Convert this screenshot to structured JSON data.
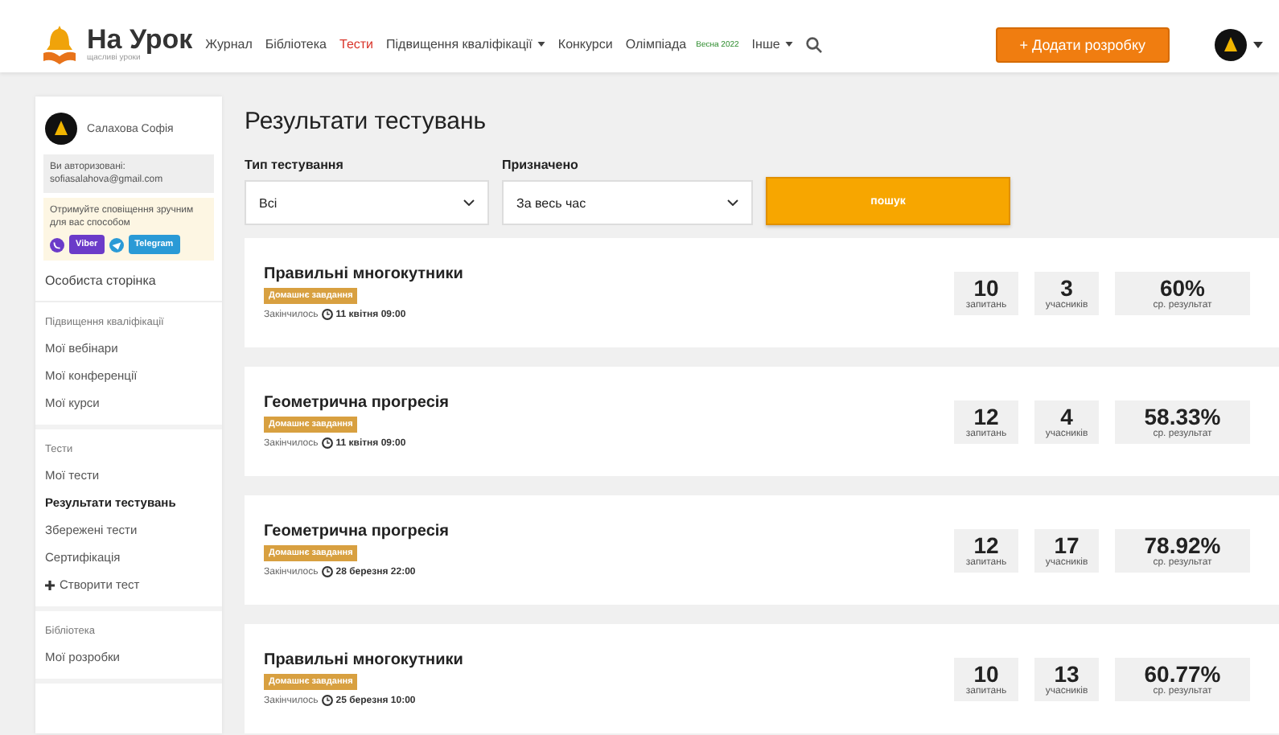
{
  "header": {
    "logo": "На Урок",
    "tagline": "щасливі уроки",
    "nav": [
      {
        "label": "Журнал",
        "selected": false,
        "dropdown": false
      },
      {
        "label": "Бібліотека",
        "selected": false,
        "dropdown": false
      },
      {
        "label": "Тести",
        "selected": true,
        "dropdown": false
      },
      {
        "label": "Підвищення кваліфікації",
        "selected": false,
        "dropdown": true
      },
      {
        "label": "Конкурси",
        "selected": false,
        "dropdown": false
      },
      {
        "label": "Олімпіада",
        "selected": false,
        "dropdown": false,
        "badge": "Весна 2022"
      },
      {
        "label": "Інше",
        "selected": false,
        "dropdown": true
      }
    ],
    "add_button": "+ Додати розробку"
  },
  "sidebar": {
    "user_name": "Салахова Софія",
    "auth_label": "Ви авторизовані:",
    "auth_email": "sofiasalahova@gmail.com",
    "notify_text": "Отримуйте сповіщення зручним для вас способом",
    "messengers": [
      "Viber",
      "Telegram"
    ],
    "profile_link": "Особиста сторінка",
    "sections": [
      {
        "items": [
          {
            "label": "Підвищення кваліфікації",
            "kind": "heading",
            "selected": false
          },
          {
            "label": "Мої вебінари",
            "kind": "link",
            "selected": false
          },
          {
            "label": "Мої конференції",
            "kind": "link",
            "selected": false
          },
          {
            "label": "Мої курси",
            "kind": "link",
            "selected": false
          }
        ]
      },
      {
        "items": [
          {
            "label": "Тести",
            "kind": "heading",
            "selected": false
          },
          {
            "label": "Мої тести",
            "kind": "link",
            "selected": false
          },
          {
            "label": "Результати тестувань",
            "kind": "link",
            "selected": true
          },
          {
            "label": "Збережені тести",
            "kind": "link",
            "selected": false
          },
          {
            "label": "Сертифікація",
            "kind": "link",
            "selected": false
          },
          {
            "label": "Створити тест",
            "kind": "add",
            "selected": false
          }
        ]
      },
      {
        "items": [
          {
            "label": "Бібліотека",
            "kind": "heading",
            "selected": false
          },
          {
            "label": "Мої розробки",
            "kind": "link",
            "selected": false
          }
        ]
      }
    ]
  },
  "main": {
    "title": "Результати тестувань",
    "filters": [
      {
        "label": "Тип тестування",
        "value": "Всі"
      },
      {
        "label": "Призначено",
        "value": "За весь час"
      }
    ],
    "search_button": "пошук",
    "results": [
      {
        "title": "Правильні многокутники",
        "badge": "Домашнє завдання",
        "status": "Закінчилось",
        "date": "11 квітня 09:00",
        "stats": [
          {
            "value": "10",
            "label": "запитань"
          },
          {
            "value": "3",
            "label": "учасників"
          },
          {
            "value": "60%",
            "label": "ср. результат"
          }
        ]
      },
      {
        "title": "Геометрична прогресія",
        "badge": "Домашнє завдання",
        "status": "Закінчилось",
        "date": "11 квітня 09:00",
        "stats": [
          {
            "value": "12",
            "label": "запитань"
          },
          {
            "value": "4",
            "label": "учасників"
          },
          {
            "value": "58.33%",
            "label": "ср. результат"
          }
        ]
      },
      {
        "title": "Геометрична прогресія",
        "badge": "Домашнє завдання",
        "status": "Закінчилось",
        "date": "28 березня 22:00",
        "stats": [
          {
            "value": "12",
            "label": "запитань"
          },
          {
            "value": "17",
            "label": "учасників"
          },
          {
            "value": "78.92%",
            "label": "ср. результат"
          }
        ]
      },
      {
        "title": "Правильні многокутники",
        "badge": "Домашнє завдання",
        "status": "Закінчилось",
        "date": "25 березня 10:00",
        "stats": [
          {
            "value": "10",
            "label": "запитань"
          },
          {
            "value": "13",
            "label": "учасників"
          },
          {
            "value": "60.77%",
            "label": "ср. результат"
          }
        ]
      }
    ]
  }
}
